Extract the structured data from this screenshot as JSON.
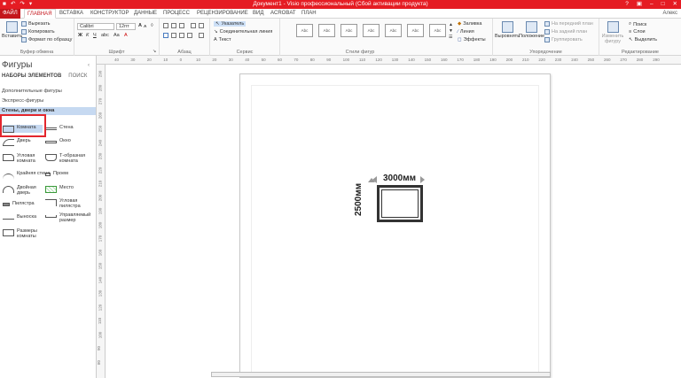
{
  "title": "Документ1 - Visio профессиональный (Сбой активации продукта)",
  "tabs": [
    "ФАЙЛ",
    "ГЛАВНАЯ",
    "ВСТАВКА",
    "КОНСТРУКТОР",
    "ДАННЫЕ",
    "ПРОЦЕСС",
    "РЕЦЕНЗИРОВАНИЕ",
    "ВИД",
    "ACROBAT",
    "ПЛАН"
  ],
  "user": "Алекс",
  "ribbon": {
    "clipboard": {
      "paste": "Вставить",
      "cut": "Вырезать",
      "copy": "Копировать",
      "format": "Формат по образцу",
      "label": "Буфер обмена"
    },
    "font": {
      "name": "Calibri",
      "size": "12пт",
      "label": "Шрифт"
    },
    "paragraph": {
      "label": "Абзац"
    },
    "tools": {
      "pointer": "Указатель",
      "connector": "Соединительная линия",
      "text": "Текст",
      "label": "Сервис"
    },
    "styles": {
      "box": "Abc",
      "label": "Стили фигур",
      "fill": "Заливка",
      "line": "Линия",
      "effects": "Эффекты"
    },
    "arrange": {
      "align": "Выровнять",
      "position": "Положение",
      "front": "На передний план",
      "back": "На задний план",
      "group": "Группировать",
      "label": "Упорядочение"
    },
    "editing": {
      "change": "Изменить фигуру",
      "find": "Поиск",
      "layers": "Слои",
      "select": "Выделить",
      "label": "Редактирование"
    }
  },
  "shapes_panel": {
    "header": "Фигуры",
    "collapse": "‹",
    "sets": "НАБОРЫ ЭЛЕМЕНТОВ",
    "search": "ПОИСК",
    "stencils": [
      "Дополнительные фигуры",
      "Экспресс-фигуры",
      "Стены, двери и окна"
    ],
    "items": [
      "Комната",
      "Стена",
      "Дверь",
      "Окно",
      "Угловая комната",
      "Т-образная комната",
      "Крайняя стена",
      "Проем",
      "Двойная дверь",
      "Место",
      "Пилястра",
      "Угловая пилястра",
      "Выноска",
      "Управляемый размер",
      "Размеры комнаты"
    ]
  },
  "ruler": {
    "h": [
      "40",
      "30",
      "20",
      "10",
      "0",
      "10",
      "20",
      "30",
      "40",
      "50",
      "60",
      "70",
      "80",
      "90",
      "100",
      "110",
      "120",
      "130",
      "140",
      "150",
      "160",
      "170",
      "180",
      "190",
      "200",
      "210",
      "220",
      "230",
      "240",
      "250",
      "260",
      "270",
      "280",
      "290"
    ],
    "v": [
      "290",
      "280",
      "270",
      "260",
      "250",
      "240",
      "230",
      "220",
      "210",
      "200",
      "190",
      "180",
      "170",
      "160",
      "150",
      "140",
      "130",
      "120",
      "110",
      "100",
      "90",
      "80"
    ]
  },
  "drawing": {
    "width": "3000мм",
    "height": "2500мм"
  }
}
